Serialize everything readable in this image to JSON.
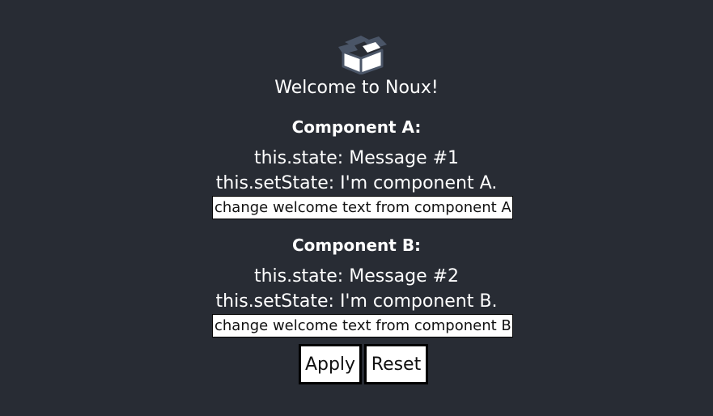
{
  "app": {
    "logo_icon": "open-box-icon",
    "welcome_text": "Welcome to Noux!"
  },
  "component_a": {
    "heading": "Component A:",
    "state_line": "this.state: Message #1",
    "setstate_line": "this.setState: I'm component A.",
    "input_value": "change welcome text from component A"
  },
  "component_b": {
    "heading": "Component B:",
    "state_line": "this.state: Message #2",
    "setstate_line": "this.setState: I'm component B.",
    "input_value": "change welcome text from component B"
  },
  "actions": {
    "apply_label": "Apply",
    "reset_label": "Reset"
  },
  "colors": {
    "background": "#282c34",
    "logo": "#4a5567"
  }
}
